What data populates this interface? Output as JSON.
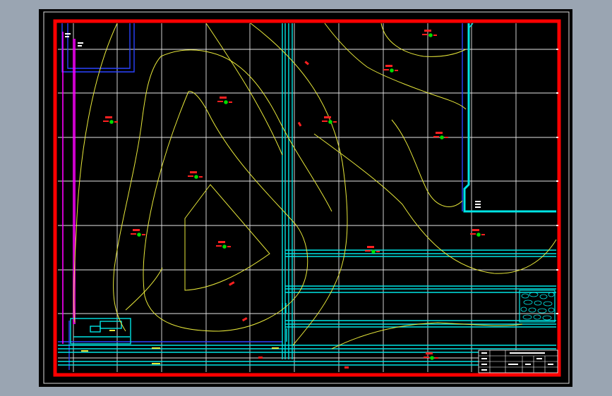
{
  "colors": {
    "background": "#9aa5b2",
    "sheet": "#000000",
    "frame_outer": "#ffffff",
    "frame_border": "#ff0000",
    "grid": "#e6e6e6",
    "contour": "#e8e83a",
    "cyan": "#00e5e5",
    "magenta": "#ff00ff",
    "blue": "#2b43ff",
    "point": "#00dd00",
    "label": "#ff2020"
  },
  "survey_points": [
    {
      "id": "p1"
    },
    {
      "id": "p2"
    },
    {
      "id": "p3"
    },
    {
      "id": "p4"
    },
    {
      "id": "p5"
    },
    {
      "id": "p6"
    },
    {
      "id": "p7"
    },
    {
      "id": "p8"
    },
    {
      "id": "p9"
    },
    {
      "id": "p10"
    },
    {
      "id": "p11"
    },
    {
      "id": "p12"
    }
  ],
  "title_block": {
    "rows": 4
  }
}
